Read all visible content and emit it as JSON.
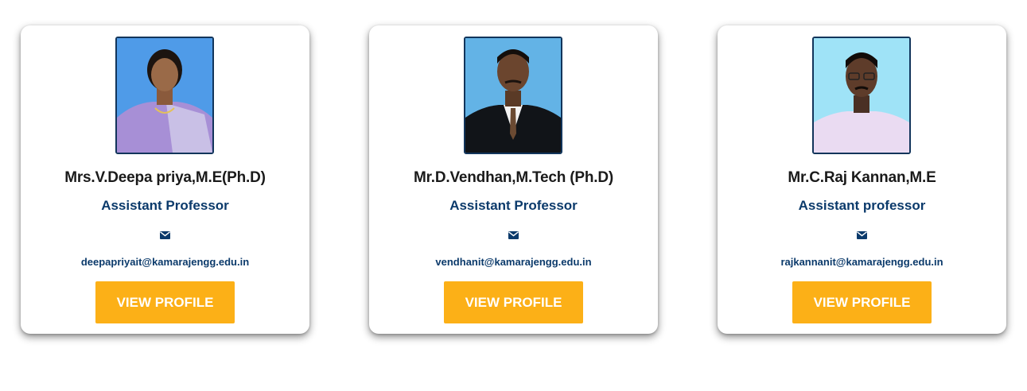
{
  "faculty": [
    {
      "name": "Mrs.V.Deepa priya,M.E(Ph.D)",
      "designation": "Assistant Professor",
      "email": "deepapriyait@kamarajengg.edu.in",
      "button_label": "VIEW PROFILE",
      "photo_alt": "Mrs.V.Deepa priya"
    },
    {
      "name": "Mr.D.Vendhan,M.Tech (Ph.D)",
      "designation": "Assistant Professor",
      "email": "vendhanit@kamarajengg.edu.in",
      "button_label": "VIEW PROFILE",
      "photo_alt": "Mr.D.Vendhan"
    },
    {
      "name": "Mr.C.Raj Kannan,M.E",
      "designation": "Assistant professor",
      "email": "rajkannanit@kamarajengg.edu.in",
      "button_label": "VIEW PROFILE",
      "photo_alt": "Mr.C.Raj Kannan"
    }
  ],
  "icons": {
    "email": "envelope-icon"
  },
  "colors": {
    "accent_button": "#fcb017",
    "designation_text": "#0b3a6b",
    "photo_border": "#12355b"
  }
}
